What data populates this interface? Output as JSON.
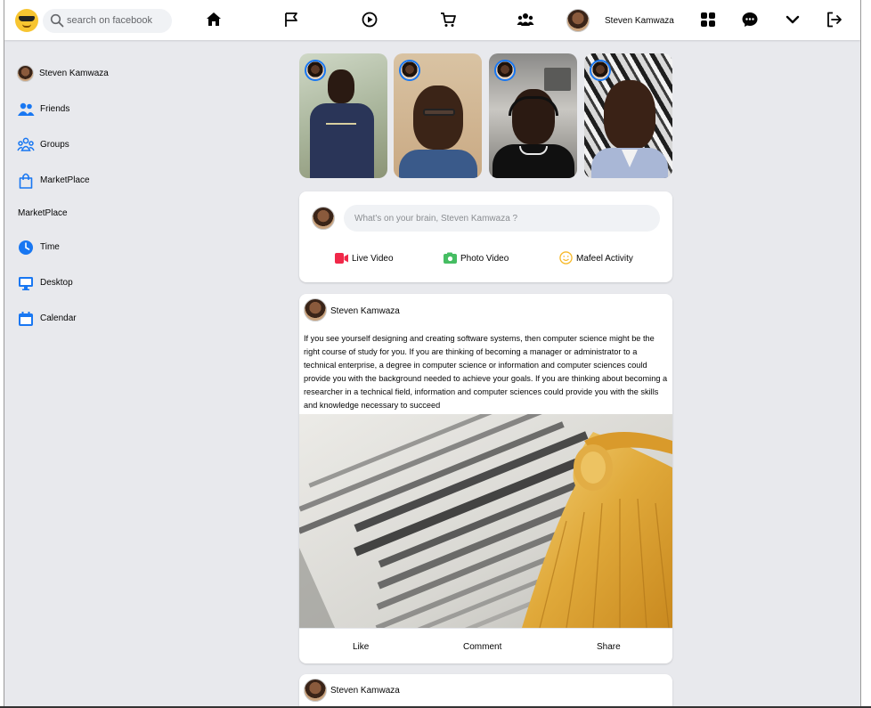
{
  "app": {
    "search_placeholder": "search on facebook",
    "accent": "#1877f2",
    "logo_icon": "sunglasses-emoji-icon"
  },
  "topnav": {
    "items": [
      {
        "icon": "home-icon"
      },
      {
        "icon": "flag-icon"
      },
      {
        "icon": "watch-play-icon"
      },
      {
        "icon": "marketplace-cart-icon"
      },
      {
        "icon": "groups-icon"
      }
    ],
    "user_name": "Steven Kamwaza",
    "right_icons": [
      "apps-grid-icon",
      "messenger-icon",
      "chevron-down-icon",
      "logout-icon"
    ]
  },
  "sidebar": {
    "items": [
      {
        "label": "Steven Kamwaza",
        "icon": "avatar"
      },
      {
        "label": "Friends",
        "icon": "friends-icon"
      },
      {
        "label": "Groups",
        "icon": "groups-icon"
      },
      {
        "label": "MarketPlace",
        "icon": "shopping-bag-icon"
      },
      {
        "label": "MarketPlace",
        "icon": ""
      },
      {
        "label": "Time",
        "icon": "clock-icon"
      },
      {
        "label": "Desktop",
        "icon": "desktop-icon"
      },
      {
        "label": "Calendar",
        "icon": "calendar-icon"
      }
    ]
  },
  "stories": [
    {
      "icon": "story-avatar"
    },
    {
      "icon": "story-avatar"
    },
    {
      "icon": "story-avatar"
    },
    {
      "icon": "story-avatar"
    }
  ],
  "composer": {
    "placeholder": "What's on your brain, Steven Kamwaza ?",
    "actions": [
      {
        "label": "Live Video",
        "icon": "live-video-icon",
        "color": "#f02849"
      },
      {
        "label": "Photo Video",
        "icon": "photo-icon",
        "color": "#45bd62"
      },
      {
        "label": "Mafeel Activity",
        "icon": "smiley-icon",
        "color": "#f7b928"
      }
    ]
  },
  "posts": [
    {
      "author": "Steven Kamwaza",
      "text": "If you see yourself designing and creating software systems, then computer science might be the right course of study for you. If you are thinking of becoming a manager or administrator to a technical enterprise, a degree in computer science or information and computer sciences could provide you with the background needed to achieve your goals. If you are thinking about becoming a researcher in a technical field, information and computer sciences could provide you with the skills and knowledge necessary to succeed",
      "image": "dictionary-page-with-graduation-tassel",
      "actions": {
        "like": "Like",
        "comment": "Comment",
        "share": "Share"
      }
    },
    {
      "author": "Steven Kamwaza"
    }
  ]
}
